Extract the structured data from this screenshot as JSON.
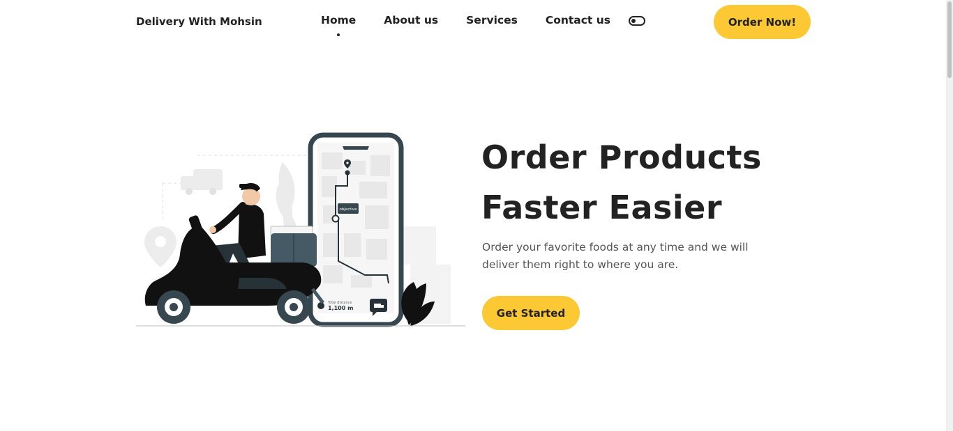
{
  "brand": {
    "name": "Delivery With Mohsin"
  },
  "nav": {
    "items": [
      {
        "label": "Home",
        "active": true
      },
      {
        "label": "About us",
        "active": false
      },
      {
        "label": "Services",
        "active": false
      },
      {
        "label": "Contact us",
        "active": false
      }
    ],
    "theme_toggle_icon": "toggle-icon",
    "cta_label": "Order Now!"
  },
  "hero": {
    "title_line1": "Order Products",
    "title_line2": "Faster Easier",
    "description": "Order your favorite foods at any time and we will deliver them right to where you are.",
    "button_label": "Get Started",
    "illustration": {
      "map_label": "objective",
      "distance_caption": "Total distance",
      "distance_value": "1,100 m"
    }
  },
  "colors": {
    "accent": "#fcc935",
    "text": "#222222",
    "muted": "#555555"
  }
}
